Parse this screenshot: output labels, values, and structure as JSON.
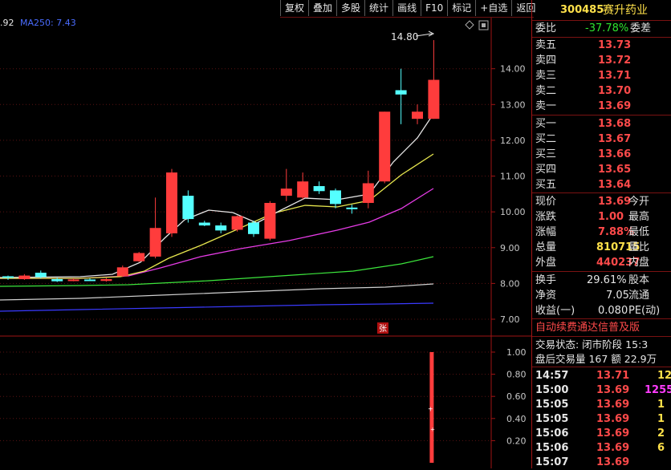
{
  "toolbar": {
    "items": [
      "复权",
      "叠加",
      "多股",
      "统计",
      "画线",
      "F10",
      "标记",
      "+自选",
      "返回"
    ]
  },
  "indicator": {
    "prev_value": ".92",
    "ma_label": "MA250: 7.43"
  },
  "chart": {
    "peak_label": "14.80",
    "limit_up_badge": "张",
    "price_axis": [
      "14.00",
      "13.00",
      "12.00",
      "11.00",
      "10.00",
      "9.00",
      "8.00",
      "7.00"
    ],
    "volume_axis": [
      "1.00",
      "0.80",
      "0.60",
      "0.40",
      "0.20"
    ],
    "colors": {
      "up": "#ff3c3c",
      "down": "#54ffff",
      "ma_white": "#e6e6e6",
      "ma_yellow": "#e6e64e",
      "ma_magenta": "#e63ce6",
      "ma_green": "#3ce63c",
      "ma_gray": "#d0d0d0",
      "ma_blue": "#3a3aff"
    }
  },
  "chart_data": {
    "type": "candlestick",
    "ylim": [
      7.0,
      14.8
    ],
    "candles": [
      {
        "o": 8.16,
        "h": 8.22,
        "l": 8.1,
        "c": 8.2,
        "dir": "down"
      },
      {
        "o": 8.12,
        "h": 8.26,
        "l": 8.1,
        "c": 8.22,
        "dir": "up"
      },
      {
        "o": 8.3,
        "h": 8.36,
        "l": 8.14,
        "c": 8.18,
        "dir": "down"
      },
      {
        "o": 8.12,
        "h": 8.16,
        "l": 8.04,
        "c": 8.06,
        "dir": "down"
      },
      {
        "o": 8.1,
        "h": 8.14,
        "l": 8.06,
        "c": 8.11,
        "dir": "up"
      },
      {
        "o": 8.11,
        "h": 8.14,
        "l": 8.08,
        "c": 8.1,
        "dir": "down"
      },
      {
        "o": 8.07,
        "h": 8.15,
        "l": 8.05,
        "c": 8.12,
        "dir": "up"
      },
      {
        "o": 8.2,
        "h": 8.5,
        "l": 8.18,
        "c": 8.45,
        "dir": "up"
      },
      {
        "o": 8.62,
        "h": 8.88,
        "l": 8.6,
        "c": 8.85,
        "dir": "up"
      },
      {
        "o": 8.75,
        "h": 10.4,
        "l": 8.7,
        "c": 9.55,
        "dir": "up"
      },
      {
        "o": 9.4,
        "h": 11.2,
        "l": 9.3,
        "c": 11.1,
        "dir": "up"
      },
      {
        "o": 10.45,
        "h": 10.6,
        "l": 9.7,
        "c": 9.8,
        "dir": "down"
      },
      {
        "o": 9.7,
        "h": 9.75,
        "l": 9.6,
        "c": 9.62,
        "dir": "down"
      },
      {
        "o": 9.62,
        "h": 9.7,
        "l": 9.4,
        "c": 9.48,
        "dir": "down"
      },
      {
        "o": 9.5,
        "h": 9.9,
        "l": 9.45,
        "c": 9.88,
        "dir": "up"
      },
      {
        "o": 9.7,
        "h": 9.75,
        "l": 9.3,
        "c": 9.38,
        "dir": "down"
      },
      {
        "o": 9.25,
        "h": 10.3,
        "l": 9.2,
        "c": 10.25,
        "dir": "up"
      },
      {
        "o": 10.45,
        "h": 11.2,
        "l": 10.3,
        "c": 10.65,
        "dir": "up"
      },
      {
        "o": 10.4,
        "h": 11.1,
        "l": 10.35,
        "c": 10.85,
        "dir": "up"
      },
      {
        "o": 10.72,
        "h": 10.85,
        "l": 10.5,
        "c": 10.58,
        "dir": "down"
      },
      {
        "o": 10.6,
        "h": 10.65,
        "l": 10.1,
        "c": 10.22,
        "dir": "down"
      },
      {
        "o": 10.12,
        "h": 10.2,
        "l": 9.95,
        "c": 10.08,
        "dir": "down"
      },
      {
        "o": 10.25,
        "h": 11.15,
        "l": 10.1,
        "c": 10.8,
        "dir": "up"
      },
      {
        "o": 10.85,
        "h": 12.8,
        "l": 10.8,
        "c": 12.8,
        "dir": "up"
      },
      {
        "o": 13.28,
        "h": 14.0,
        "l": 12.45,
        "c": 13.4,
        "dir": "down"
      },
      {
        "o": 12.6,
        "h": 13.0,
        "l": 12.45,
        "c": 12.8,
        "dir": "up"
      },
      {
        "o": 12.6,
        "h": 14.8,
        "l": 12.6,
        "c": 13.69,
        "dir": "up"
      }
    ],
    "volume_scale": [
      0,
      1.0
    ],
    "last_volume": 1.0
  },
  "panel": {
    "code": "300485",
    "name": "赛升药业",
    "weibi_label": "委比",
    "weibi_value": "-37.78%",
    "weicha_label": "委差",
    "asks": [
      {
        "label": "卖五",
        "price": "13.73"
      },
      {
        "label": "卖四",
        "price": "13.72"
      },
      {
        "label": "卖三",
        "price": "13.71"
      },
      {
        "label": "卖二",
        "price": "13.70"
      },
      {
        "label": "卖一",
        "price": "13.69"
      }
    ],
    "bids": [
      {
        "label": "买一",
        "price": "13.68"
      },
      {
        "label": "买二",
        "price": "13.67"
      },
      {
        "label": "买三",
        "price": "13.66"
      },
      {
        "label": "买四",
        "price": "13.65"
      },
      {
        "label": "买五",
        "price": "13.64"
      }
    ],
    "quote": [
      {
        "label": "现价",
        "value": "13.69",
        "right": "今开"
      },
      {
        "label": "涨跌",
        "value": "1.00",
        "right": "最高"
      },
      {
        "label": "涨幅",
        "value": "7.88%",
        "right": "最低"
      },
      {
        "label": "总量",
        "value": "810715",
        "right": "量比"
      },
      {
        "label": "外盘",
        "value": "440237",
        "right": "内盘"
      }
    ],
    "fund": [
      {
        "label": "换手",
        "value": "29.61%",
        "right": "股本"
      },
      {
        "label": "净资",
        "value": "7.05",
        "right": "流通"
      },
      {
        "label": "收益(一)",
        "value": "0.080",
        "right": "PE(动)"
      }
    ],
    "banner": "自动续费通达信普及版",
    "status_line": "交易状态: 闭市阶段 15:3",
    "after_hours_line": "盘后交易量 167 额 22.9万",
    "ticks": [
      {
        "time": "14:57",
        "price": "13.71",
        "vol": "12"
      },
      {
        "time": "15:00",
        "price": "13.69",
        "vol": "1255"
      },
      {
        "time": "15:05",
        "price": "13.69",
        "vol": "1"
      },
      {
        "time": "15:05",
        "price": "13.69",
        "vol": "1"
      },
      {
        "time": "15:06",
        "price": "13.69",
        "vol": "2"
      },
      {
        "time": "15:06",
        "price": "13.69",
        "vol": "6"
      },
      {
        "time": "15:07",
        "price": "13.69",
        "vol": ""
      }
    ]
  }
}
